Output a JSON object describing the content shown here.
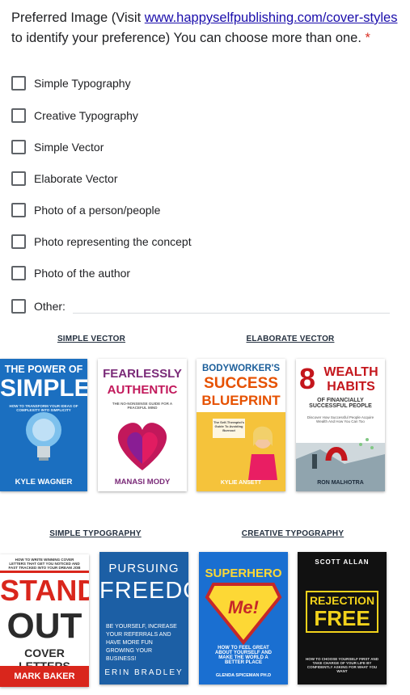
{
  "question": {
    "prefix": "Preferred Image (Visit ",
    "link_text": "www.happyselfpublishing.com/cover-styles",
    "suffix": " to identify your preference) You can choose more than one.",
    "required_mark": "*"
  },
  "options": [
    "Simple Typography",
    "Creative Typography",
    "Simple Vector",
    "Elaborate Vector",
    "Photo of a person/people",
    "Photo representing the concept",
    "Photo of the author",
    "Other:"
  ],
  "sections": {
    "simple_vector": "SIMPLE VECTOR",
    "elaborate_vector": "ELABORATE VECTOR",
    "simple_typography": "SIMPLE TYPOGRAPHY",
    "creative_typography": "CREATIVE TYPOGRAPHY"
  },
  "books": {
    "b1": {
      "title_a": "THE POWER OF",
      "title_b": "SIMPLE",
      "sub": "HOW TO TRANSFORM YOUR IDEAS OF COMPLEXITY INTO SIMPLICITY",
      "author": "KYLE WAGNER",
      "color": "#1b6fc0"
    },
    "b2": {
      "title_a": "FEARLESSLY",
      "title_b": "AUTHENTIC",
      "sub": "THE NO-NONSENSE GUIDE FOR A PEACEFUL MIND",
      "author": "MANASI MODY",
      "color": "#7a2a78"
    },
    "b3": {
      "title_a": "BODYWORKER'S",
      "title_b": "SUCCESS",
      "title_c": "BLUEPRINT",
      "sub": "The Self-Therapist's Guide To Avoiding Burnout",
      "author": "KYLIE ANSETT",
      "color": "#e8a21a"
    },
    "b4": {
      "title_a": "8",
      "title_b": "WEALTH",
      "title_c": "HABITS",
      "title_d": "OF FINANCIALLY SUCCESSFUL PEOPLE",
      "sub": "Discover How Successful People Acquire Wealth And How You Can Too",
      "author": "RON MALHOTRA",
      "color": "#c4161c"
    },
    "b5": {
      "top": "HOW TO WRITE WINNING COVER LETTERS THAT GET YOU NOTICED AND FAST TRACKED INTO YOUR DREAM JOB",
      "title_a": "STAND",
      "title_b": "OUT",
      "title_c": "COVER LETTERS",
      "author": "MARK BAKER",
      "color": "#d9261c"
    },
    "b6": {
      "title_a": "PURSUING",
      "title_b": "FREEDOM",
      "sub": "BE YOURSELF, INCREASE YOUR REFERRALS AND HAVE MORE FUN GROWING YOUR BUSINESS!",
      "author": "ERIN BRADLEY",
      "color": "#1c5fa5"
    },
    "b7": {
      "title_a": "SUPERHERO",
      "title_b": "Me!",
      "sub": "HOW TO FEEL GREAT ABOUT YOURSELF AND MAKE THE WORLD A BETTER PLACE",
      "author": "GLENDA SPICEMAN PH.D",
      "color": "#1a6fd1"
    },
    "b8": {
      "author": "SCOTT ALLAN",
      "title_a": "REJECTION",
      "title_b": "FREE",
      "sub": "HOW TO CHOOSE YOURSELF FIRST AND TAKE CHARGE OF YOUR LIFE BY CONFIDENTLY ASKING FOR WHAT YOU WANT",
      "color": "#f2d21b"
    }
  }
}
